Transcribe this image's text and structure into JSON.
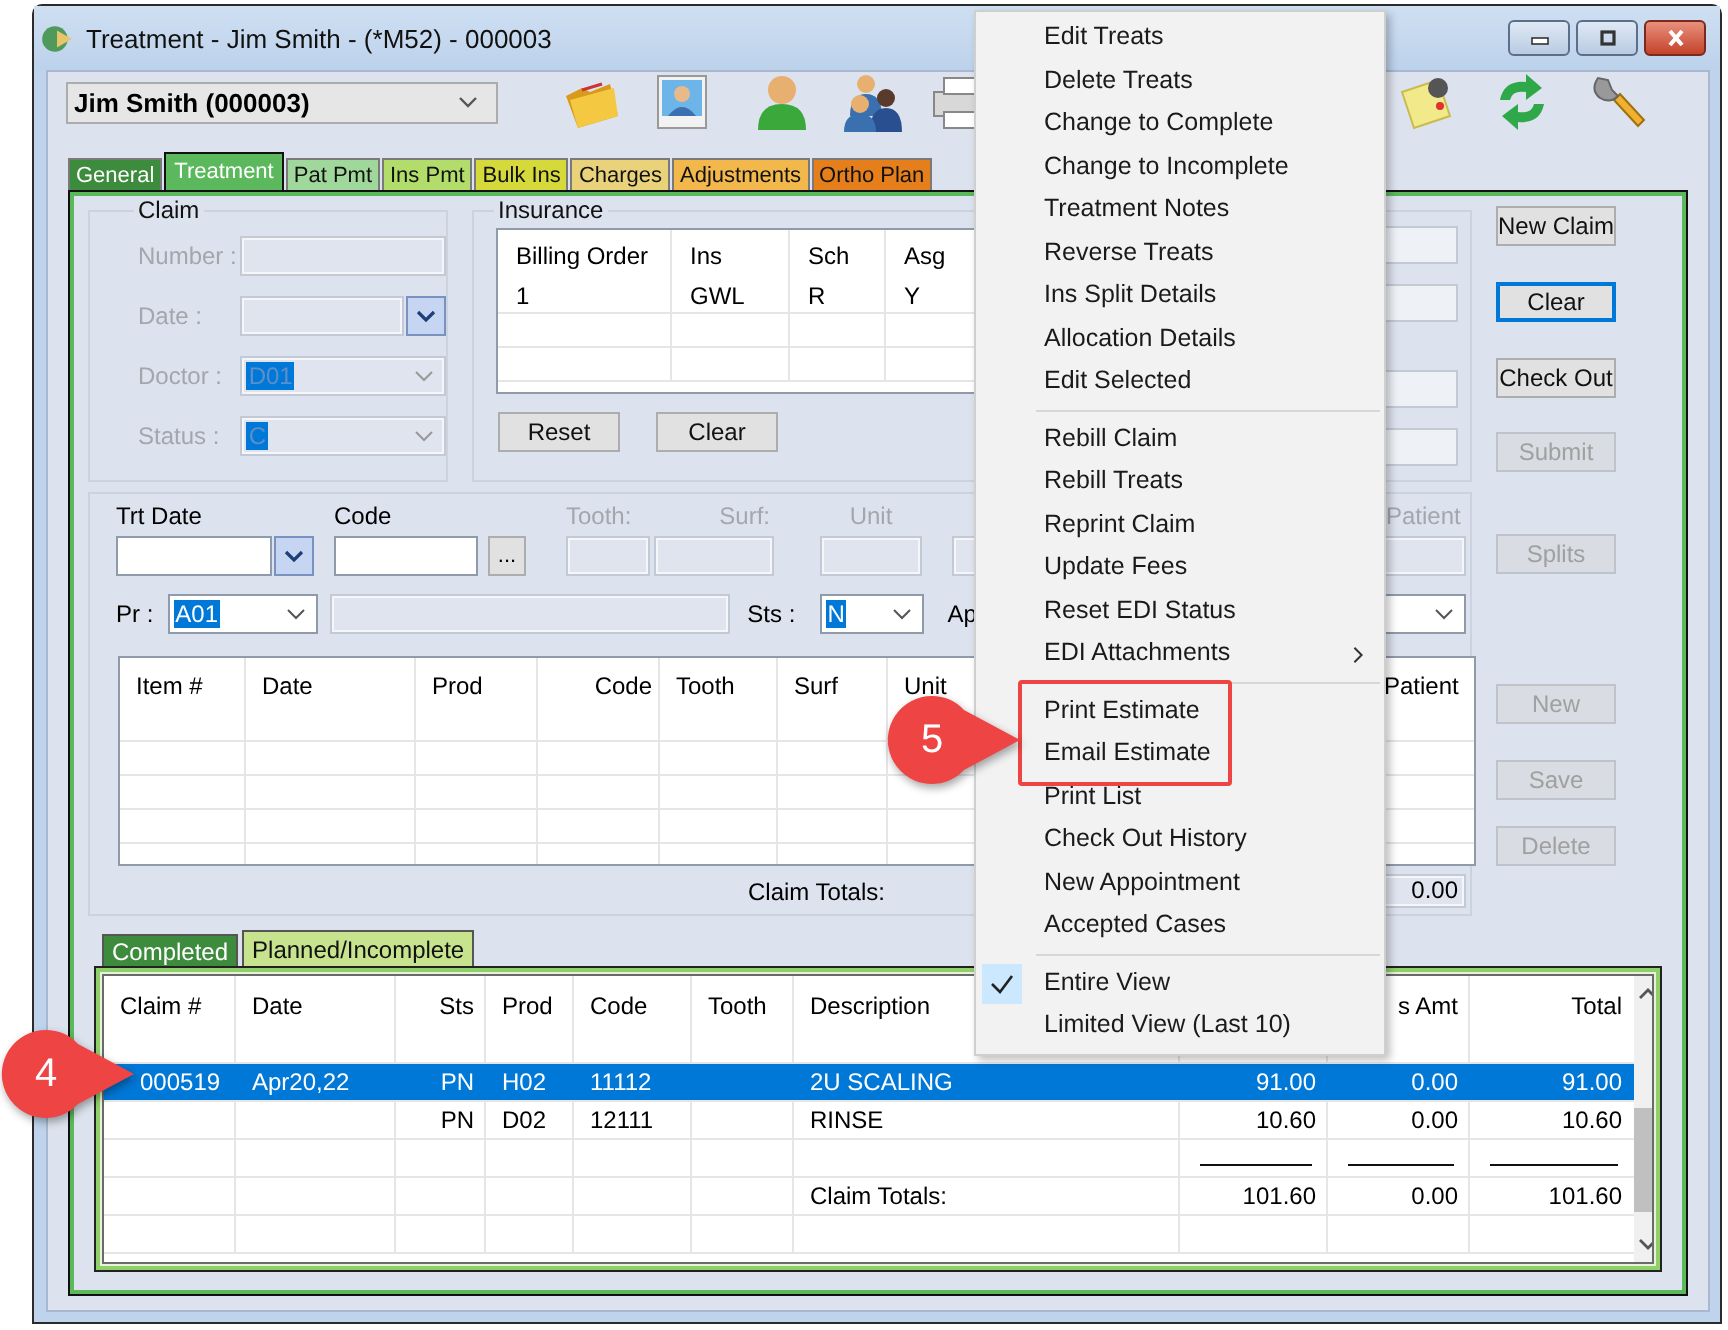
{
  "window": {
    "title": "Treatment - Jim Smith - (*M52) - 000003"
  },
  "patient": {
    "value": "Jim Smith (000003)"
  },
  "tabs": [
    {
      "label": "General",
      "selected": false,
      "color": "#3d8b3d"
    },
    {
      "label": "Treatment",
      "selected": true,
      "color": "#5cb85c"
    },
    {
      "label": "Pat Pmt",
      "selected": false,
      "color": "#9fd89a"
    },
    {
      "label": "Ins Pmt",
      "selected": false,
      "color": "#b2dd6a"
    },
    {
      "label": "Bulk Ins",
      "selected": false,
      "color": "#d6d93a"
    },
    {
      "label": "Charges",
      "selected": false,
      "color": "#ead27a"
    },
    {
      "label": "Adjustments",
      "selected": false,
      "color": "#f2b84b"
    },
    {
      "label": "Ortho Plan",
      "selected": false,
      "color": "#e57f1c"
    }
  ],
  "claim": {
    "title": "Claim",
    "fields": [
      {
        "label": "Number :",
        "kind": "text",
        "disabled": true
      },
      {
        "label": "Date :",
        "kind": "date",
        "disabled": true
      },
      {
        "label": "Doctor :",
        "kind": "combo",
        "value": "D01",
        "disabled": true
      },
      {
        "label": "Status :",
        "kind": "combo",
        "value": "C",
        "disabled": true
      }
    ]
  },
  "insurance": {
    "title": "Insurance",
    "columns": [
      "Billing Order",
      "Ins",
      "Sch",
      "Asg"
    ],
    "rows": [
      [
        "1",
        "GWL",
        "R",
        "Y"
      ]
    ],
    "buttons": [
      "Reset",
      "Clear"
    ]
  },
  "side_buttons": [
    {
      "label": "New Claim",
      "disabled": false,
      "focused": false
    },
    {
      "label": "Clear",
      "disabled": false,
      "focused": true
    },
    {
      "label": "Check Out",
      "disabled": false,
      "focused": false
    },
    {
      "label": "Submit",
      "disabled": true,
      "focused": false
    }
  ],
  "entry": {
    "fields": [
      {
        "label": "Trt Date",
        "kind": "date",
        "disabled": false
      },
      {
        "label": "Code",
        "kind": "lookup",
        "disabled": false
      },
      {
        "label": "Tooth:",
        "kind": "text",
        "disabled": true
      },
      {
        "label": "Surf:",
        "kind": "text",
        "disabled": true
      },
      {
        "label": "Unit",
        "kind": "text",
        "disabled": true
      },
      {
        "label": "Patient",
        "kind": "text",
        "disabled": true
      }
    ],
    "lookup_button": "...",
    "provider": {
      "label": "Pr :",
      "value": "A01"
    },
    "status": {
      "label": "Sts :",
      "value": "N"
    },
    "cut_label": "Ap",
    "columns": [
      "Item #",
      "Date",
      "Prod",
      "Code",
      "Tooth",
      "Surf",
      "Unit",
      null,
      "Patient"
    ],
    "totals_label": "Claim Totals:",
    "totals_value": "0.00"
  },
  "entry_buttons": [
    {
      "label": "Splits",
      "disabled": true
    },
    {
      "label": "New",
      "disabled": true
    },
    {
      "label": "Save",
      "disabled": true
    },
    {
      "label": "Delete",
      "disabled": true
    }
  ],
  "subtabs": [
    {
      "label": "Completed",
      "selected": false
    },
    {
      "label": "Planned/Incomplete",
      "selected": true
    }
  ],
  "claims_table": {
    "columns": [
      "Claim #",
      "Date",
      "Sts",
      "Prod",
      "Code",
      "Tooth",
      "Description",
      null,
      "s Amt",
      "Total"
    ],
    "rows": [
      {
        "kind": "item",
        "selected": true,
        "cells": [
          "000519",
          "Apr20,22",
          "PN",
          "H02",
          "11112",
          null,
          "2U SCALING",
          "91.00",
          "0.00",
          "91.00"
        ]
      },
      {
        "kind": "item",
        "selected": false,
        "cells": [
          null,
          null,
          "PN",
          "D02",
          "12111",
          null,
          "RINSE",
          "10.60",
          "0.00",
          "10.60"
        ]
      },
      {
        "kind": "rule",
        "selected": false
      },
      {
        "kind": "item",
        "selected": false,
        "cells": [
          null,
          null,
          null,
          null,
          null,
          null,
          "Claim Totals:",
          "101.60",
          "0.00",
          "101.60"
        ]
      }
    ]
  },
  "context_menu": {
    "sections": [
      [
        {
          "highlighted": false,
          "items": [
            {
              "label": "Edit Treats"
            },
            {
              "label": "Delete Treats"
            },
            {
              "label": "Change to Complete"
            },
            {
              "label": "Change to Incomplete"
            },
            {
              "label": "Treatment Notes"
            },
            {
              "label": "Reverse Treats"
            },
            {
              "label": "Ins Split Details"
            },
            {
              "label": "Allocation Details"
            },
            {
              "label": "Edit Selected"
            }
          ]
        }
      ],
      [
        {
          "highlighted": false,
          "items": [
            {
              "label": "Rebill Claim",
              "submenu": false
            },
            {
              "label": "Rebill Treats",
              "submenu": false
            },
            {
              "label": "Reprint Claim",
              "submenu": false
            },
            {
              "label": "Update Fees",
              "submenu": false
            },
            {
              "label": "Reset EDI Status",
              "submenu": false
            },
            {
              "label": "EDI Attachments",
              "submenu": true
            }
          ]
        }
      ],
      [
        {
          "highlighted": true,
          "items": [
            {
              "label": "Print Estimate"
            },
            {
              "label": "Email Estimate"
            }
          ]
        },
        {
          "highlighted": false,
          "items": [
            {
              "label": "Print List"
            },
            {
              "label": "Check Out History"
            },
            {
              "label": "New Appointment"
            },
            {
              "label": "Accepted Cases"
            }
          ]
        }
      ],
      [
        {
          "highlighted": false,
          "items": [
            {
              "label": "Entire View",
              "checked": true
            },
            {
              "label": "Limited View (Last 10)",
              "checked": false
            }
          ]
        }
      ]
    ]
  },
  "callouts": [
    {
      "label": "5"
    },
    {
      "label": "4"
    }
  ]
}
